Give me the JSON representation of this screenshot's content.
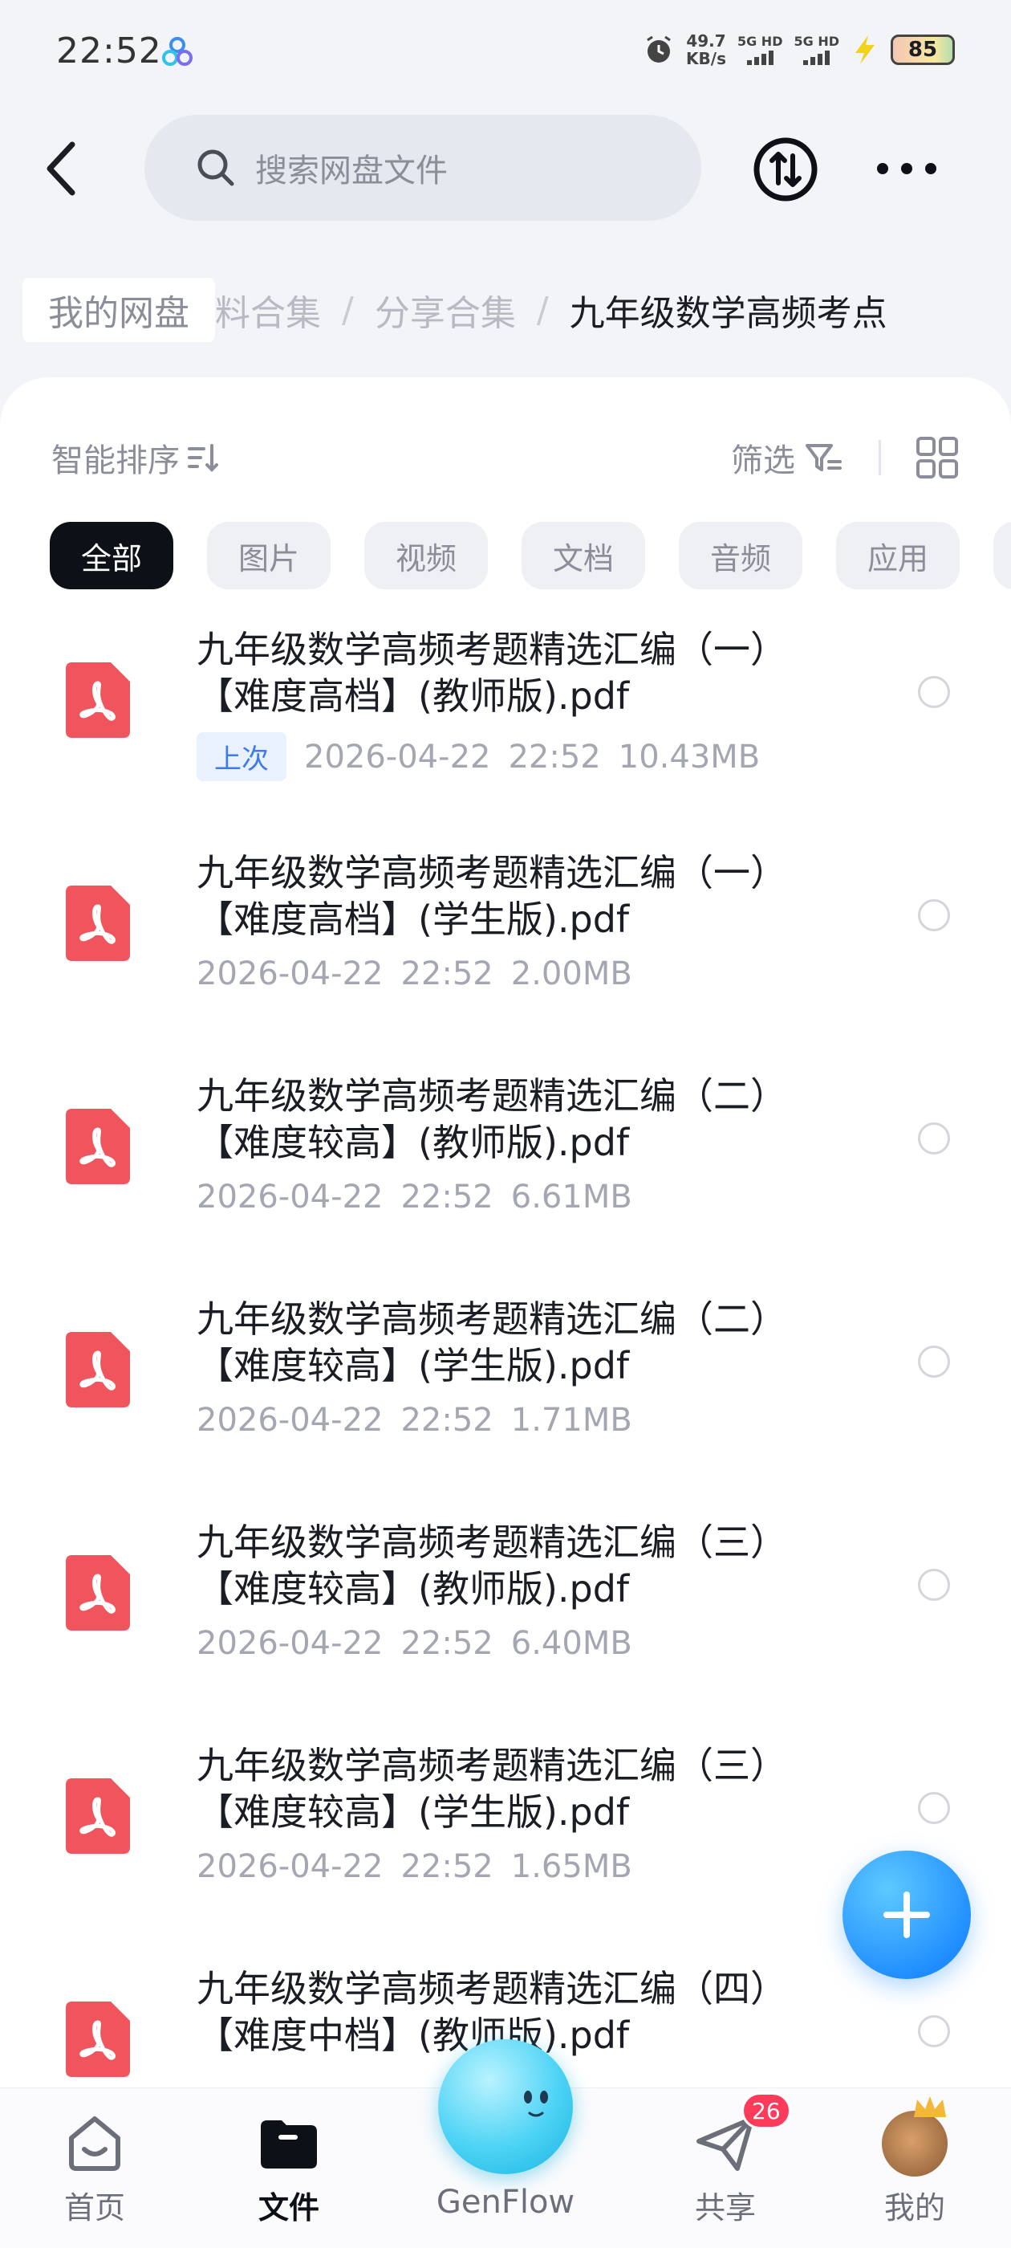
{
  "status_bar": {
    "time": "22:52",
    "net_speed_value": "49.7",
    "net_speed_unit": "KB/s",
    "signal_1": "5G HD",
    "signal_2": "5G HD",
    "battery": "85"
  },
  "header": {
    "search_placeholder": "搜索网盘文件"
  },
  "breadcrumb": {
    "items": [
      "我的网盘",
      "资料合集",
      "分享合集",
      "九年级数学高频考点"
    ],
    "visible_partial": "料合集"
  },
  "toolbar": {
    "sort_label": "智能排序",
    "filter_label": "筛选"
  },
  "filter_chips": [
    {
      "label": "全部",
      "active": true
    },
    {
      "label": "图片",
      "active": false
    },
    {
      "label": "视频",
      "active": false
    },
    {
      "label": "文档",
      "active": false
    },
    {
      "label": "音频",
      "active": false
    },
    {
      "label": "应用",
      "active": false
    }
  ],
  "files": [
    {
      "name": "九年级数学高频考题精选汇编（一）【难度高档】(教师版).pdf",
      "badge": "上次",
      "date": "2026-04-22",
      "time": "22:52",
      "size": "10.43MB"
    },
    {
      "name": "九年级数学高频考题精选汇编（一）【难度高档】(学生版).pdf",
      "date": "2026-04-22",
      "time": "22:52",
      "size": "2.00MB"
    },
    {
      "name": "九年级数学高频考题精选汇编（二）【难度较高】(教师版).pdf",
      "date": "2026-04-22",
      "time": "22:52",
      "size": "6.61MB"
    },
    {
      "name": "九年级数学高频考题精选汇编（二）【难度较高】(学生版).pdf",
      "date": "2026-04-22",
      "time": "22:52",
      "size": "1.71MB"
    },
    {
      "name": "九年级数学高频考题精选汇编（三）【难度较高】(教师版).pdf",
      "date": "2026-04-22",
      "time": "22:52",
      "size": "6.40MB"
    },
    {
      "name": "九年级数学高频考题精选汇编（三）【难度较高】(学生版).pdf",
      "date": "2026-04-22",
      "time": "22:52",
      "size": "1.65MB"
    },
    {
      "name": "九年级数学高频考题精选汇编（四）【难度中档】(教师版).pdf",
      "date": "",
      "time": "",
      "size": ""
    }
  ],
  "bottom_nav": {
    "home": "首页",
    "files": "文件",
    "genflow": "GenFlow",
    "share": "共享",
    "share_badge": "26",
    "mine": "我的"
  },
  "colors": {
    "accent": "#1e8cff",
    "pdf_red": "#f0545c",
    "badge_red": "#ff3b5c"
  }
}
